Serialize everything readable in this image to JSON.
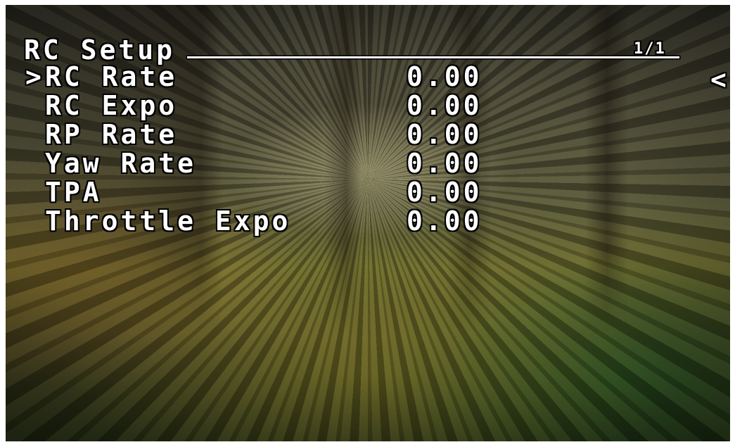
{
  "screen": {
    "title": "RC Setup",
    "page_indicator": "1/1",
    "cursor_symbol": ">",
    "back_symbol": "<",
    "items": [
      {
        "label": "RC Rate",
        "value": "0.00"
      },
      {
        "label": "RC Expo",
        "value": "0.00"
      },
      {
        "label": "RP Rate",
        "value": "0.00"
      },
      {
        "label": "Yaw Rate",
        "value": "0.00"
      },
      {
        "label": "TPA",
        "value": "0.00"
      },
      {
        "label": "Throttle Expo",
        "value": "0.00"
      }
    ]
  },
  "icons": {
    "cursor": "chevron-right-icon",
    "back": "chevron-left-icon"
  },
  "colors": {
    "osd_text": "#ffffff",
    "osd_outline": "#000000"
  }
}
